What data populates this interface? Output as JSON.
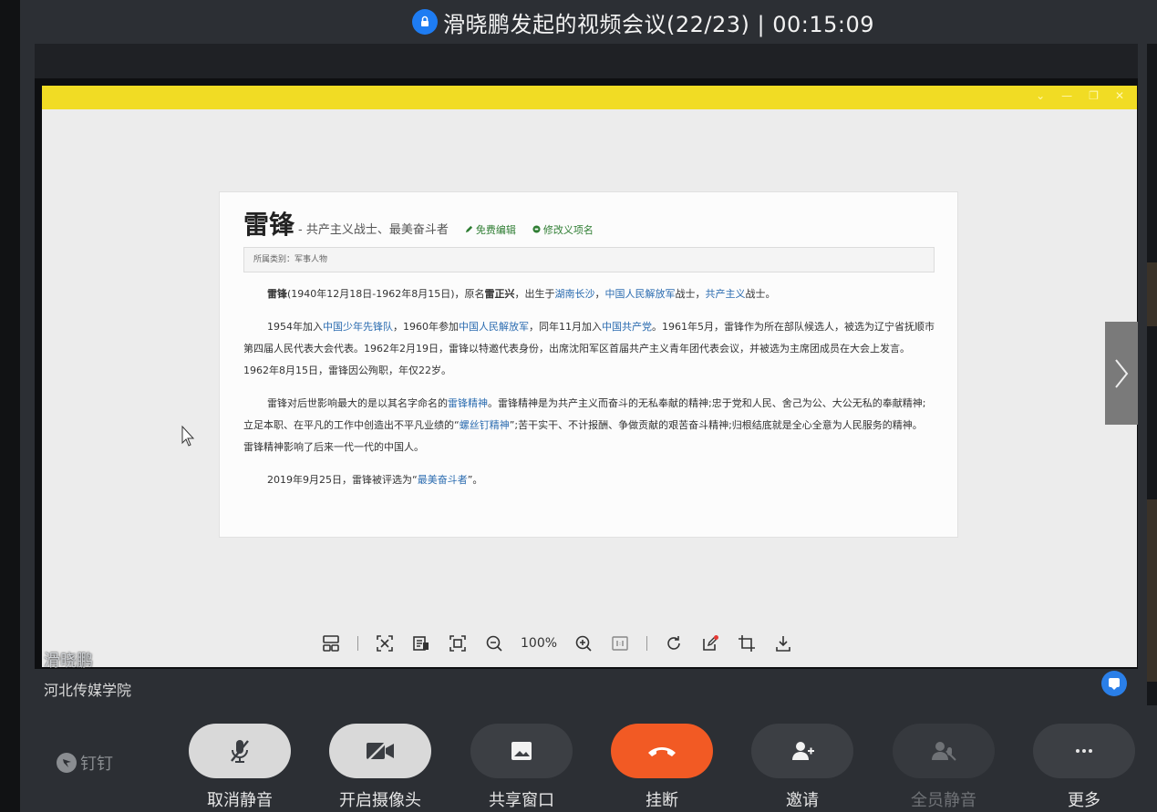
{
  "meeting": {
    "title": "滑晓鹏发起的视频会议(22/23)  |  00:15:09"
  },
  "article": {
    "title": "雷锋",
    "subtitle": "- 共产主义战士、最美奋斗者",
    "edit_free": "免费编辑",
    "edit_name": "修改义项名",
    "category": "所属类别：军事人物",
    "p1": {
      "a": "雷锋",
      "b": "(1940年12月18日-1962年8月15日)，原名",
      "c": "雷正兴",
      "d": "，出生于",
      "e": "湖南长沙",
      "f": "，",
      "g": "中国人民解放军",
      "h": "战士，",
      "i": "共产主义",
      "j": "战士。"
    },
    "p2": {
      "a": "1954年加入",
      "b": "中国少年先锋队",
      "c": "，1960年参加",
      "d": "中国人民解放军",
      "e": "，同年11月加入",
      "f": "中国共产党",
      "g": "。1961年5月，雷锋作为所在部队候选人，被选为辽宁省抚顺市第四届人民代表大会代表。1962年2月19日，雷锋以特邀代表身份，出席沈阳军区首届共产主义青年团代表会议，并被选为主席团成员在大会上发言。1962年8月15日，雷锋因公殉职，年仅22岁。"
    },
    "p3": {
      "a": "雷锋对后世影响最大的是以其名字命名的",
      "b": "雷锋精神",
      "c": "。雷锋精神是为共产主义而奋斗的无私奉献的精神;忠于党和人民、舍己为公、大公无私的奉献精神;立足本职、在平凡的工作中创造出不平凡业绩的“",
      "d": "螺丝钉精神",
      "e": "”;苦干实干、不计报酬、争做贡献的艰苦奋斗精神;归根结底就是全心全意为人民服务的精神。 雷锋精神影响了后来一代一代的中国人。"
    },
    "p4": {
      "a": "2019年9月25日，雷锋被评选为“",
      "b": "最美奋斗者",
      "c": "”。"
    }
  },
  "viewer_toolbar": {
    "zoom": "100%"
  },
  "presenter": {
    "name": "滑晓鹏",
    "org": "河北传媒学院"
  },
  "brand": {
    "name": "钉钉"
  },
  "controls": {
    "mute": "取消静音",
    "camera": "开启摄像头",
    "share": "共享窗口",
    "hangup": "挂断",
    "invite": "邀请",
    "mute_all": "全员静音",
    "more": "更多"
  },
  "colors": {
    "accent_yellow": "#f1dc24",
    "hangup_red": "#f25a24",
    "link_blue": "#2b6cb0",
    "shield_blue": "#1e7cf2"
  }
}
